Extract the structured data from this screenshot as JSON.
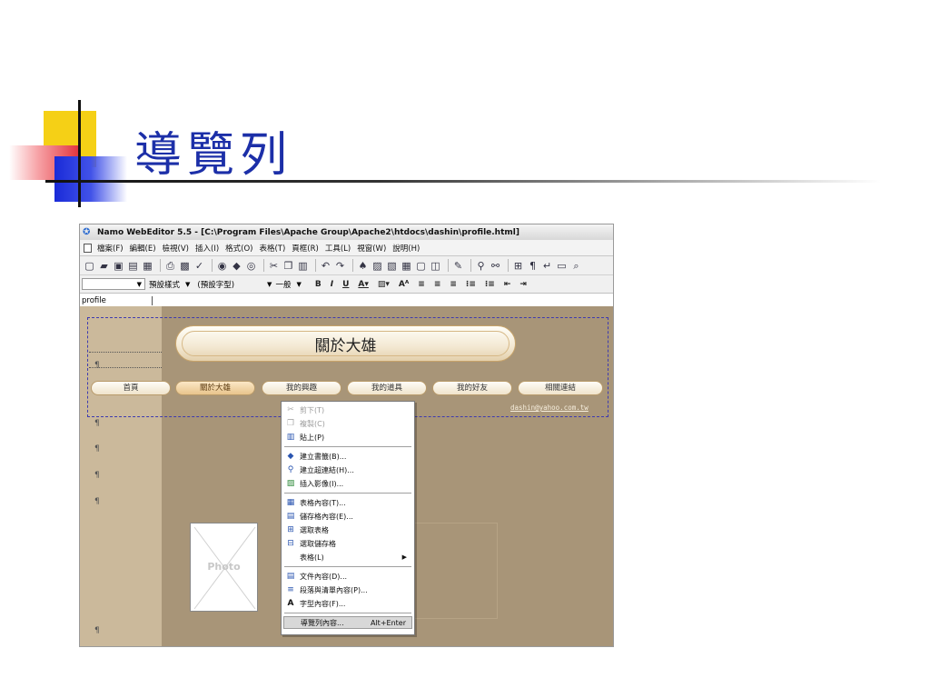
{
  "slide": {
    "title": "導覽列"
  },
  "window": {
    "title": "Namo WebEditor 5.5 - [C:\\Program Files\\Apache Group\\Apache2\\htdocs\\dashin\\profile.html]"
  },
  "menubar": {
    "items": [
      "檔案(F)",
      "編輯(E)",
      "檢視(V)",
      "插入(I)",
      "格式(O)",
      "表格(T)",
      "頁框(R)",
      "工具(L)",
      "視窗(W)",
      "說明(H)"
    ]
  },
  "formatbar": {
    "style_value": "預設樣式",
    "font_value": "(預設字型)",
    "size_value": "一般",
    "bold_label": "B",
    "italic_label": "I",
    "underline_label": "U"
  },
  "tabbar": {
    "active_tab": "profile"
  },
  "page": {
    "banner_text": "關於大雄",
    "email": "dashin@yahoo.com.tw",
    "photo_label": "Photo",
    "nav": [
      {
        "label": "首頁",
        "active": false
      },
      {
        "label": "關於大雄",
        "active": true
      },
      {
        "label": "我的興趣",
        "active": false
      },
      {
        "label": "我的道具",
        "active": false
      },
      {
        "label": "我的好友",
        "active": false
      },
      {
        "label": "相關連結",
        "active": false
      }
    ]
  },
  "context_menu": {
    "cut": "剪下(T)",
    "copy": "複製(C)",
    "paste": "貼上(P)",
    "bookmark": "建立書籤(B)...",
    "hyperlink": "建立超連結(H)...",
    "insert_image": "插入影像(I)...",
    "table_props": "表格內容(T)...",
    "cell_props": "儲存格內容(E)...",
    "select_table": "選取表格",
    "select_cell": "選取儲存格",
    "table_sub": "表格(L)",
    "doc_props": "文件內容(D)...",
    "para_props": "段落與清單內容(P)...",
    "font_props": "字型內容(F)...",
    "navbar_props": "導覽列內容...",
    "navbar_shortcut": "Alt+Enter"
  },
  "colors": {
    "title_blue": "#1c2fa8",
    "page_bg": "#a89578",
    "left_column": "#cbb99b"
  }
}
